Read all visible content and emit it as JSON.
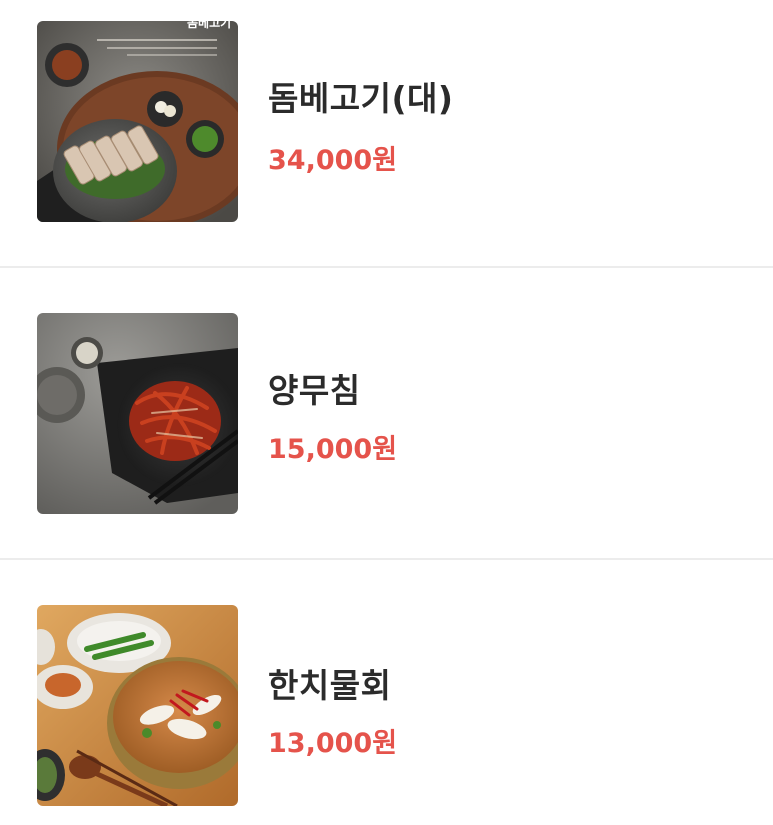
{
  "menu": {
    "items": [
      {
        "name": "돔베고기(대)",
        "price": "34,000원",
        "image_label": "돔베고기"
      },
      {
        "name": "양무침",
        "price": "15,000원"
      },
      {
        "name": "한치물회",
        "price": "13,000원"
      }
    ]
  },
  "colors": {
    "price": "#e5534b",
    "name": "#2b2b2b",
    "divider": "#ececec",
    "background": "#ffffff"
  }
}
